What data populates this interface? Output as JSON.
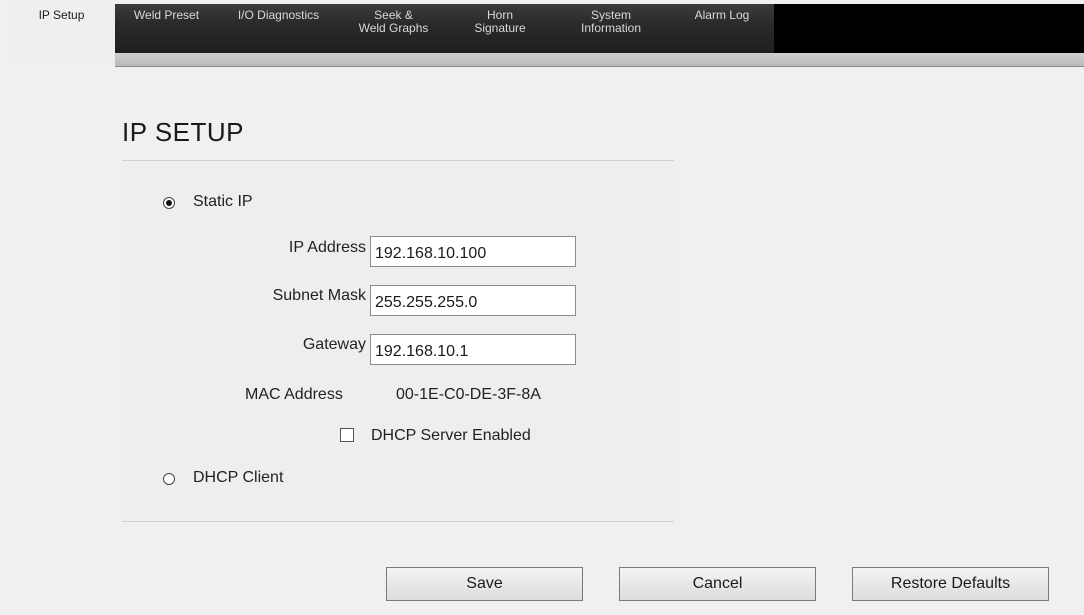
{
  "nav": {
    "tabs": [
      {
        "label": "IP Setup",
        "active": true
      },
      {
        "label": "Weld Preset",
        "active": false
      },
      {
        "label": "I/O Diagnostics",
        "active": false
      },
      {
        "label": "Seek &\nWeld Graphs",
        "active": false
      },
      {
        "label": "Horn\nSignature",
        "active": false
      },
      {
        "label": "System\nInformation",
        "active": false
      },
      {
        "label": "Alarm Log",
        "active": false
      }
    ]
  },
  "page": {
    "title": "IP SETUP"
  },
  "form": {
    "static_ip_label": "Static IP",
    "static_ip_selected": true,
    "ip_address_label": "IP Address",
    "ip_address_value": "192.168.10.100",
    "subnet_mask_label": "Subnet Mask",
    "subnet_mask_value": "255.255.255.0",
    "gateway_label": "Gateway",
    "gateway_value": "192.168.10.1",
    "mac_address_label": "MAC Address",
    "mac_address_value": "00-1E-C0-DE-3F-8A",
    "dhcp_server_label": "DHCP Server Enabled",
    "dhcp_server_checked": false,
    "dhcp_client_label": "DHCP Client",
    "dhcp_client_selected": false
  },
  "actions": {
    "save_label": "Save",
    "cancel_label": "Cancel",
    "restore_label": "Restore Defaults"
  },
  "colors": {
    "nav_background": "#000000",
    "page_background": "#f0f0f0",
    "active_tab": "#efefef"
  }
}
